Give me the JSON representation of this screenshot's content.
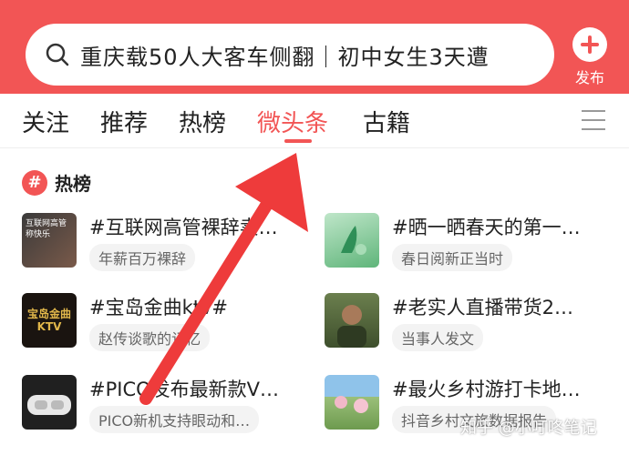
{
  "search": {
    "query": "重庆载50人大客车侧翻｜初中女生3天遭"
  },
  "publish": {
    "label": "发布"
  },
  "tabs": [
    {
      "label": "关注"
    },
    {
      "label": "推荐"
    },
    {
      "label": "热榜"
    },
    {
      "label": "微头条",
      "active": true
    },
    {
      "label": "古籍"
    }
  ],
  "hot": {
    "title": "热榜",
    "items": [
      {
        "title": "#互联网高管裸辞卖…",
        "subtitle": "年薪百万裸辞",
        "thumb_text": "互联网高管称快乐"
      },
      {
        "title": "#晒一晒春天的第一…",
        "subtitle": "春日阅新正当时"
      },
      {
        "title": "#宝岛金曲ktv#",
        "subtitle": "赵传谈歌的记忆",
        "thumb_text": "宝岛金曲KTV"
      },
      {
        "title": "#老实人直播带货2…",
        "subtitle": "当事人发文"
      },
      {
        "title": "#PICO发布最新款V…",
        "subtitle": "PICO新机支持眼动和…"
      },
      {
        "title": "#最火乡村游打卡地…",
        "subtitle": "抖音乡村文旅数据报告"
      }
    ]
  },
  "watermark": "知乎 @小叮咚笔记",
  "colors": {
    "accent": "#f25555",
    "arrow": "#ee3b3b"
  }
}
